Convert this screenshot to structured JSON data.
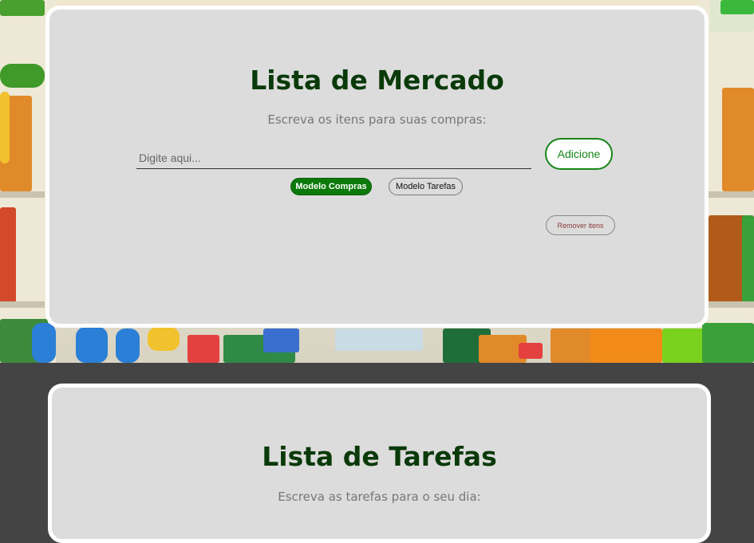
{
  "market": {
    "title": "Lista de Mercado",
    "subtitle": "Escreva os itens para suas compras:",
    "input_placeholder": "Digite aqui...",
    "add_button": "Adicione",
    "mode_buttons": [
      "Modelo Compras",
      "Modelo Tarefas"
    ],
    "active_mode": "Modelo Compras",
    "remove_button": "Remover itens"
  },
  "tasks": {
    "title": "Lista de Tarefas",
    "subtitle": "Escreva as tarefas para o seu dia:"
  },
  "colors": {
    "accent_green": "#178417",
    "title_green": "#0a3a0a",
    "card_bg": "#dcdcdc",
    "page_bg": "#444444"
  }
}
